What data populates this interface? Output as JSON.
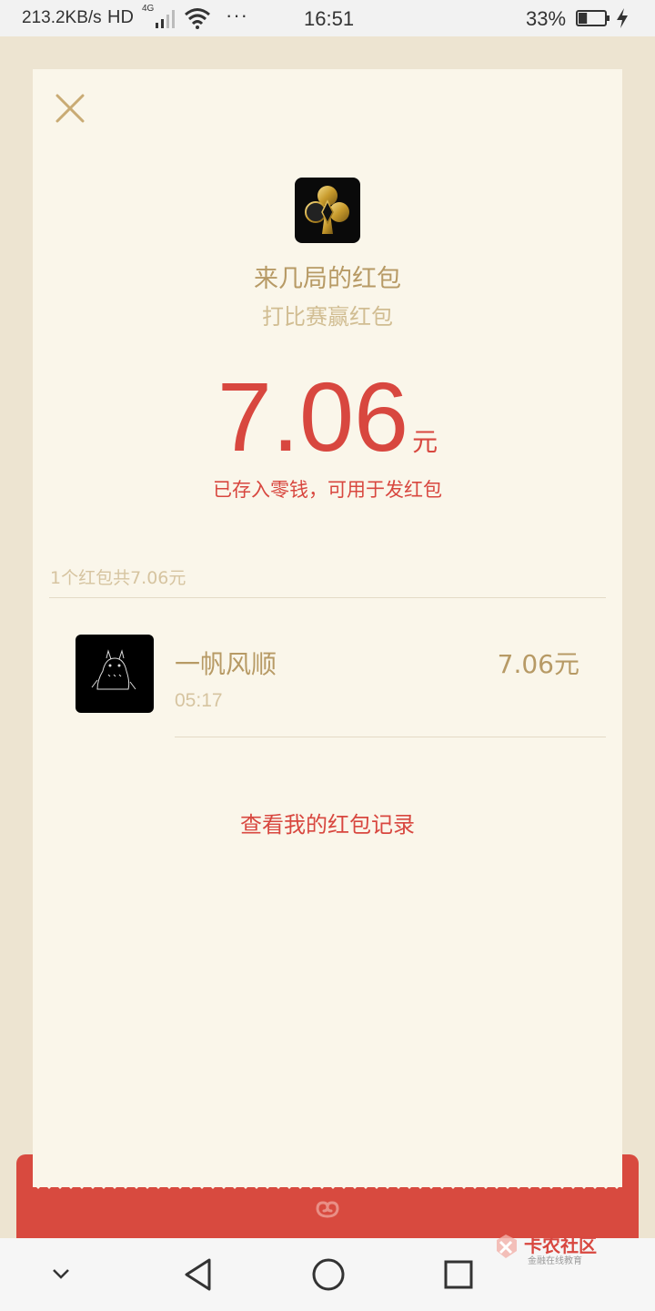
{
  "status_bar": {
    "net_speed": "213.2KB/s",
    "hd": "HD",
    "network": "4G",
    "more": "···",
    "time": "16:51",
    "battery": "33%",
    "battery_level": 0.33
  },
  "panel": {
    "app_name": "来几局的红包",
    "subtitle": "打比赛赢红包",
    "amount": "7.06",
    "unit": "元",
    "note": "已存入零钱，可用于发红包",
    "count_text": "1个红包共7.06元",
    "records_link": "查看我的红包记录"
  },
  "entries": [
    {
      "name": "一帆风顺",
      "time": "05:17",
      "amount": "7.06元"
    }
  ],
  "watermark": {
    "title": "卡农社区",
    "subtitle": "金融在线教育"
  },
  "nav": [
    "chevron-down-icon",
    "back-triangle-icon",
    "home-circle-icon",
    "recent-square-icon"
  ],
  "colors": {
    "background": "#ede4d1",
    "panel": "#faf6ea",
    "gold": "#b79a65",
    "red": "#d8473f"
  }
}
